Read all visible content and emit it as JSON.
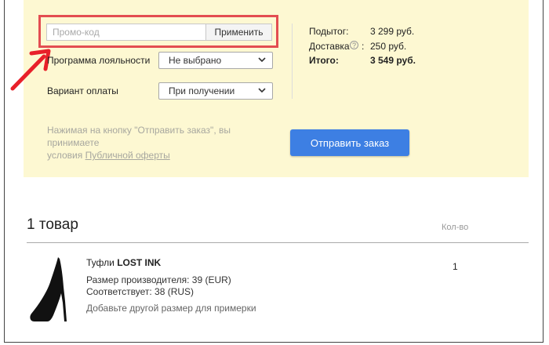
{
  "promo": {
    "placeholder": "Промо-код",
    "apply_label": "Применить"
  },
  "loyalty": {
    "label": "Программа лояльности",
    "selected": "Не выбрано"
  },
  "payment": {
    "label": "Вариант оплаты",
    "selected": "При получении"
  },
  "summary": {
    "subtotal_label": "Подытог:",
    "subtotal_value": "3 299 руб.",
    "delivery_label": "Доставка",
    "delivery_help": "?",
    "delivery_colon": ":",
    "delivery_value": "250 руб.",
    "total_label": "Итого:",
    "total_value": "3 549 руб."
  },
  "note": {
    "text_line1": "Нажимая на кнопку \"Отправить заказ\", вы принимаете",
    "text_prefix": "условия ",
    "link": "Публичной оферты"
  },
  "submit_label": "Отправить заказ",
  "cart": {
    "count_title": "1 товар",
    "qty_header": "Кол-во",
    "item": {
      "name_prefix": "Туфли",
      "brand": "LOST INK",
      "size_line": "Размер производителя: 39 (EUR)",
      "match_line": "Соответствует: 38 (RUS)",
      "add_size_link": "Добавьте другой размер для примерки",
      "quantity": "1"
    }
  },
  "colors": {
    "panel_bg": "#fdf8d2",
    "highlight": "#e34d51",
    "arrow": "#e8202a",
    "submit_bg": "#3d7fe3"
  }
}
